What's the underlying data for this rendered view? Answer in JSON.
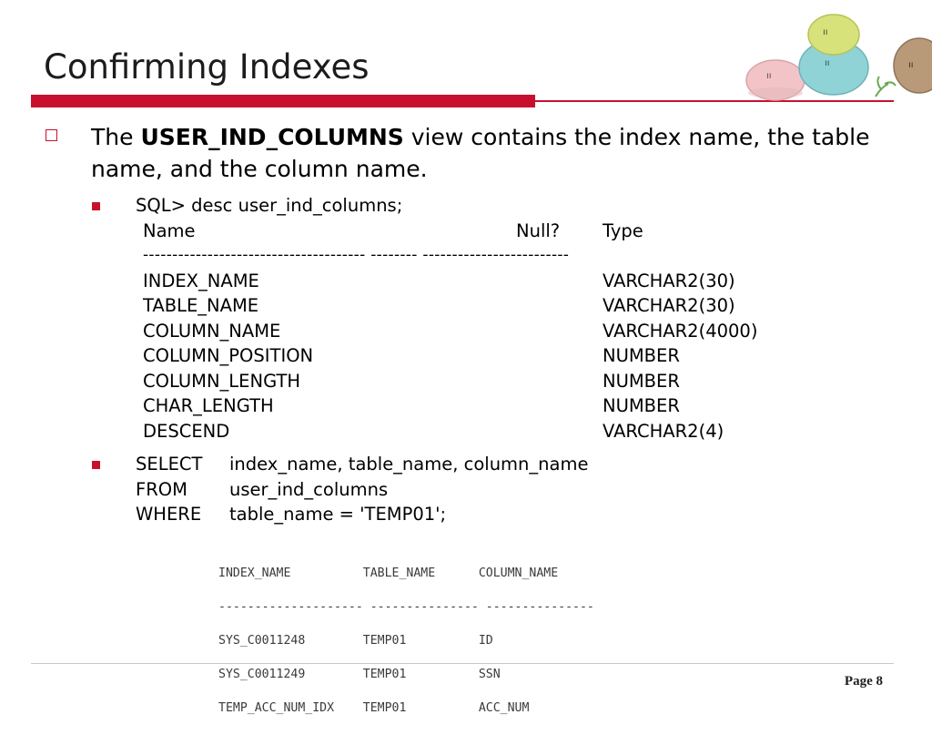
{
  "slide": {
    "title": "Confirming Indexes",
    "page_label": "Page 8"
  },
  "bullet1": {
    "prefix": "The ",
    "bold": "USER_IND_COLUMNS",
    "suffix": " view contains the index name, the table name, and the column name."
  },
  "desc": {
    "command": "SQL> desc user_ind_columns;",
    "headers": {
      "name": "Name",
      "null": "Null?",
      "type": "Type"
    },
    "separator": "-------------------------------------- -------- -------------------------",
    "rows": [
      {
        "name": "INDEX_NAME",
        "type": "VARCHAR2(30)"
      },
      {
        "name": "TABLE_NAME",
        "type": "VARCHAR2(30)"
      },
      {
        "name": "COLUMN_NAME",
        "type": "VARCHAR2(4000)"
      },
      {
        "name": "COLUMN_POSITION",
        "type": "NUMBER"
      },
      {
        "name": "COLUMN_LENGTH",
        "type": "NUMBER"
      },
      {
        "name": "CHAR_LENGTH",
        "type": "NUMBER"
      },
      {
        "name": "DESCEND",
        "type": "VARCHAR2(4)"
      }
    ]
  },
  "query": {
    "select_kw": "SELECT",
    "select_val": "index_name, table_name, column_name",
    "from_kw": "FROM",
    "from_val": "user_ind_columns",
    "where_kw": "WHERE",
    "where_val": "table_name = 'TEMP01';"
  },
  "result": {
    "header": "INDEX_NAME          TABLE_NAME      COLUMN_NAME",
    "separator": "-------------------- --------------- ---------------",
    "rows": [
      "SYS_C0011248        TEMP01          ID",
      "SYS_C0011249        TEMP01          SSN",
      "TEMP_ACC_NUM_IDX    TEMP01          ACC_NUM"
    ]
  },
  "colors": {
    "accent": "#c8102e"
  }
}
